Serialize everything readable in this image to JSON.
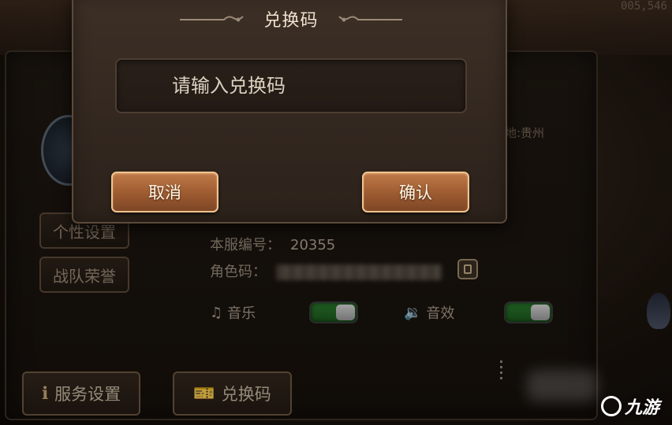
{
  "background": {
    "counter": "005,546",
    "location": "地:贵州",
    "side_buttons": {
      "personal_settings": "个性设置",
      "team_honor": "战队荣誉"
    },
    "info": {
      "server_number_label": "本服编号：",
      "server_number_value": "20355",
      "role_code_label": "角色码："
    },
    "audio": {
      "music_label": "音乐",
      "music_on": true,
      "sfx_label": "音效",
      "sfx_on": true
    },
    "bottom_buttons": {
      "service_settings": "服务设置",
      "redeem_code": "兑换码"
    }
  },
  "modal": {
    "title": "兑换码",
    "input_placeholder": "请输入兑换码",
    "input_value": "",
    "cancel_label": "取消",
    "confirm_label": "确认"
  },
  "watermark": {
    "text": "九游"
  },
  "colors": {
    "button_primary": "#b06a3c",
    "button_border": "#f0c48e",
    "toggle_on": "#2b7a2e",
    "modal_bg": "#3c2f26"
  }
}
